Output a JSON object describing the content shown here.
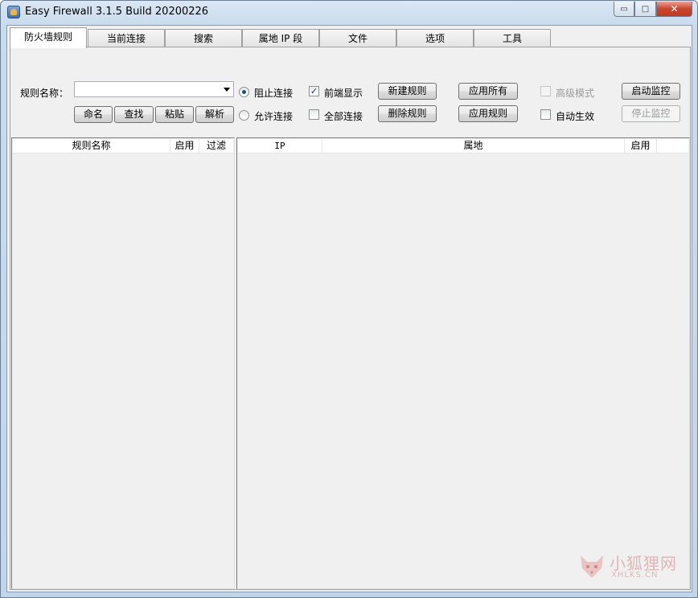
{
  "window": {
    "title": "Easy Firewall 3.1.5 Build 20200226"
  },
  "caption": {
    "minimize": "▭",
    "maximize": "□",
    "close": "✕"
  },
  "tabs": [
    {
      "label": "防火墙规则"
    },
    {
      "label": "当前连接"
    },
    {
      "label": "搜索"
    },
    {
      "label": "属地 IP 段"
    },
    {
      "label": "文件"
    },
    {
      "label": "选项"
    },
    {
      "label": "工具"
    }
  ],
  "rule_panel": {
    "rule_name_label": "规则名称：",
    "rule_name_value": "",
    "buttons": {
      "rename": "命名",
      "find": "查找",
      "paste": "粘贴",
      "parse": "解析",
      "new_rule": "新建规则",
      "delete_rule": "删除规则",
      "apply_all": "应用所有",
      "apply_rule": "应用规则",
      "start_monitor": "启动监控",
      "stop_monitor": "停止监控"
    },
    "radios": {
      "block": "阻止连接",
      "allow": "允许连接"
    },
    "checks": {
      "foreground": "前端显示",
      "all_connections": "全部连接",
      "advanced_mode": "高级模式",
      "auto_apply": "自动生效"
    }
  },
  "rules_list": {
    "columns": [
      "规则名称",
      "启用",
      "过滤"
    ],
    "rows": []
  },
  "ip_list": {
    "columns": [
      "IP",
      "属地",
      "启用"
    ],
    "rows": []
  },
  "watermark": {
    "main": "小狐狸网",
    "sub": "XHLKS.CN"
  },
  "colors": {
    "close_button": "#c9462c",
    "check_mark": "#1c3e6e"
  }
}
